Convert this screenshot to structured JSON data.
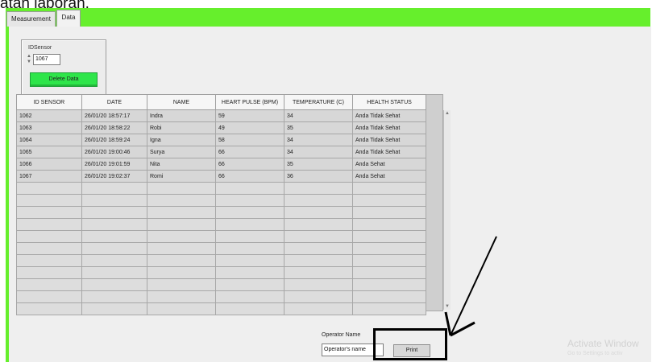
{
  "top_text": "atan laporan.",
  "tabs": [
    {
      "label": "Measurement"
    },
    {
      "label": "Data"
    }
  ],
  "id_sensor": {
    "label": "IDSensor",
    "value": "1067"
  },
  "delete_button": {
    "label": "Delete Data"
  },
  "table": {
    "headers": [
      "ID SENSOR",
      "DATE",
      "NAME",
      "HEART PULSE (BPM)",
      "TEMPERATURE (C)",
      "HEALTH STATUS"
    ],
    "rows": [
      [
        "1062",
        "26/01/20 18:57:17",
        "Indra",
        "59",
        "34",
        "Anda Tidak Sehat"
      ],
      [
        "1063",
        "26/01/20 18:58:22",
        "Robi",
        "49",
        "35",
        "Anda Tidak Sehat"
      ],
      [
        "1064",
        "26/01/20 18:59:24",
        "Igna",
        "58",
        "34",
        "Anda Tidak Sehat"
      ],
      [
        "1065",
        "26/01/20 19:00:46",
        "Surya",
        "66",
        "34",
        "Anda Tidak Sehat"
      ],
      [
        "1066",
        "26/01/20 19:01:59",
        "Nita",
        "66",
        "35",
        "Anda Sehat"
      ],
      [
        "1067",
        "26/01/20 19:02:37",
        "Romi",
        "66",
        "36",
        "Anda Sehat"
      ]
    ]
  },
  "operator": {
    "label": "Operator Name",
    "value": "Operator's name"
  },
  "print_button": {
    "label": "Print"
  },
  "watermark": {
    "title": "Activate Window",
    "subtitle": "Go to Settings to activ"
  }
}
